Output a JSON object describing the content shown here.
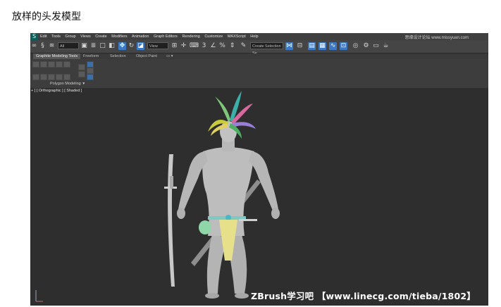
{
  "page": {
    "heading": "放样的头发模型"
  },
  "menubar": {
    "items": [
      "Edit",
      "Tools",
      "Group",
      "Views",
      "Create",
      "Modifiers",
      "Animation",
      "Graph Editors",
      "Rendering",
      "Customize",
      "MAXScript",
      "Help"
    ],
    "watermark": "思缘设计论坛 www.missyuan.com"
  },
  "toolbar": {
    "filter_value": "All",
    "view_value": "View",
    "selection_set_placeholder": "Create Selection Se"
  },
  "ribbon": {
    "tabs": [
      "Graphite Modeling Tools",
      "Freeform",
      "Selection",
      "Object Paint"
    ],
    "panel_label": "Polygon Modeling"
  },
  "viewport": {
    "label": "+ ] [ Orthographic ] [ Shaded ]",
    "watermark": "ZBrush学习吧 【www.linecg.com/tieba/1802】"
  },
  "colors": {
    "app_bg": "#2f2f2f",
    "toolbar_bg": "#454545",
    "accent_blue": "#3b79c6",
    "ribbon_border": "#c9a227",
    "model_gray": "#b8b8b8"
  }
}
